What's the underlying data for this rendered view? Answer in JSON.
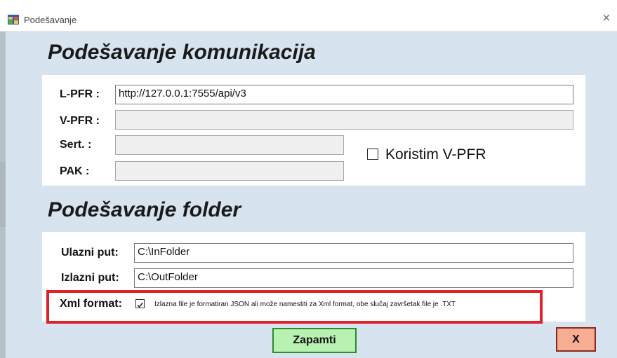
{
  "window": {
    "title": "Podešavanje",
    "close_glyph": "×",
    "icon": "app-window-icon"
  },
  "communication": {
    "heading": "Podešavanje komunikacija",
    "lpfr_label": "L-PFR :",
    "lpfr_value": "http://127.0.0.1:7555/api/v3",
    "vpfr_label": "V-PFR :",
    "vpfr_value": "",
    "sert_label": "Sert. :",
    "sert_value": "",
    "pak_label": "PAK :",
    "pak_value": "",
    "use_vpfr_label": "Koristim V-PFR",
    "use_vpfr_checked": false
  },
  "folder": {
    "heading": "Podešavanje folder",
    "input_label": "Ulazni put:",
    "input_value": "C:\\InFolder",
    "output_label": "Izlazni put:",
    "output_value": "C:\\OutFolder",
    "xml_label": "Xml format:",
    "xml_checked": true,
    "xml_check_glyph": "✓",
    "xml_hint": "Izlazna file je formatiran JSON ali može namestiti za Xml format, obe slučaj završetak file je .TXT"
  },
  "buttons": {
    "save_label": "Zapamti",
    "close_label": "X"
  },
  "colors": {
    "window_bg": "#d7e3ef",
    "save_bg": "#b9f1b2",
    "close_bg": "#f7ad93",
    "highlight": "#e0202a"
  }
}
